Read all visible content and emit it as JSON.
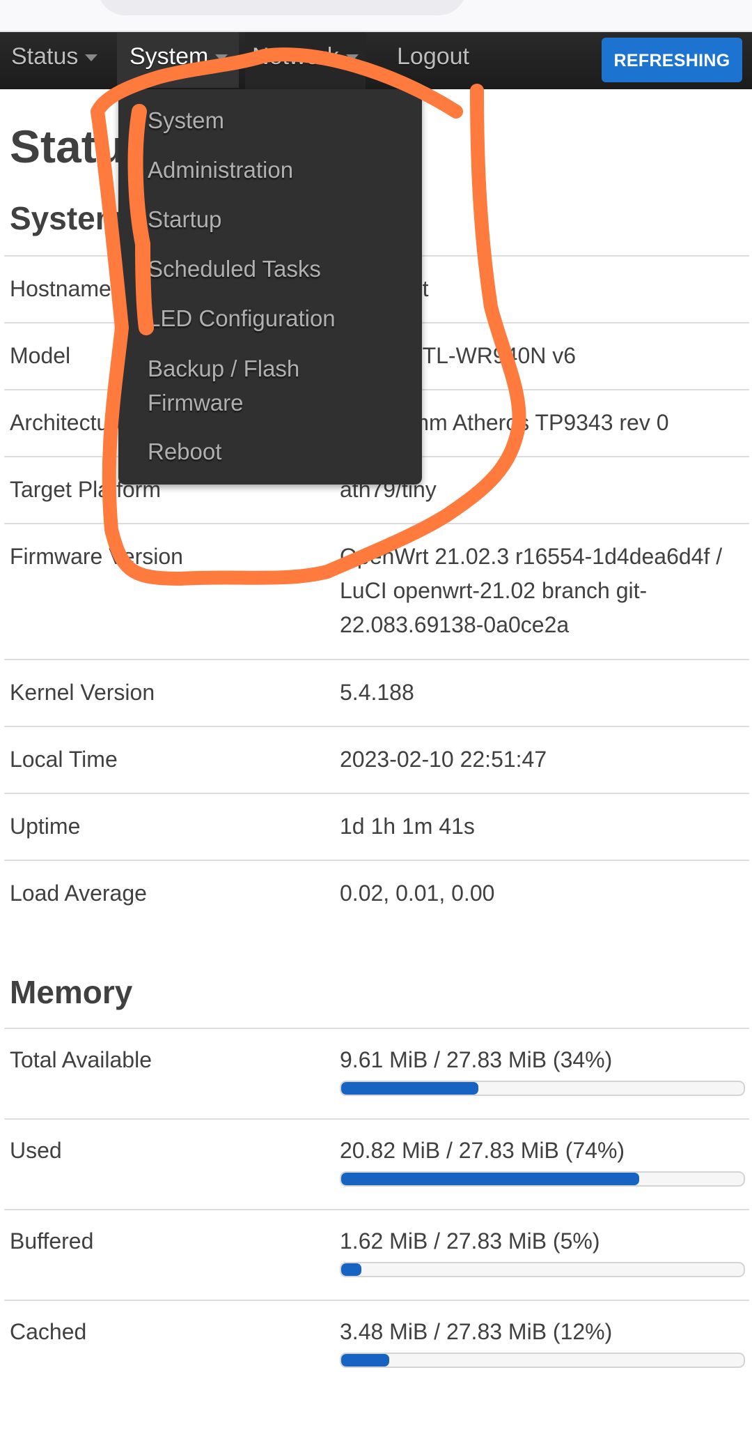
{
  "navbar": {
    "items": [
      {
        "label": "Status",
        "has_caret": true
      },
      {
        "label": "System",
        "has_caret": true,
        "active": true
      },
      {
        "label": "Network",
        "has_caret": true
      },
      {
        "label": "Logout",
        "has_caret": false
      }
    ],
    "refresh_button": "REFRESHING"
  },
  "dropdown": {
    "items": [
      "System",
      "Administration",
      "Startup",
      "Scheduled Tasks",
      "LED Configuration",
      "Backup / Flash Firmware",
      "Reboot"
    ]
  },
  "page": {
    "title": "Status",
    "system_section": "System",
    "memory_section": "Memory"
  },
  "system": {
    "rows": [
      {
        "label": "Hostname",
        "value": "OpenWrt"
      },
      {
        "label": "Model",
        "value": "TP-Link TL-WR940N v6"
      },
      {
        "label": "Architecture",
        "value": "Qualcomm Atheros TP9343 rev 0"
      },
      {
        "label": "Target Platform",
        "value": "ath79/tiny"
      },
      {
        "label": "Firmware Version",
        "value": "OpenWrt 21.02.3 r16554-1d4dea6d4f / LuCI openwrt-21.02 branch git-22.083.69138-0a0ce2a"
      },
      {
        "label": "Kernel Version",
        "value": "5.4.188"
      },
      {
        "label": "Local Time",
        "value": "2023-02-10 22:51:47"
      },
      {
        "label": "Uptime",
        "value": "1d 1h 1m 41s"
      },
      {
        "label": "Load Average",
        "value": "0.02, 0.01, 0.00"
      }
    ]
  },
  "memory": {
    "rows": [
      {
        "label": "Total Available",
        "value": "9.61 MiB / 27.83 MiB (34%)",
        "percent": 34
      },
      {
        "label": "Used",
        "value": "20.82 MiB / 27.83 MiB (74%)",
        "percent": 74
      },
      {
        "label": "Buffered",
        "value": "1.62 MiB / 27.83 MiB (5%)",
        "percent": 5
      },
      {
        "label": "Cached",
        "value": "3.48 MiB / 27.83 MiB (12%)",
        "percent": 12
      }
    ]
  },
  "colors": {
    "accent": "#1d74d0",
    "bar_fill": "#1763c2",
    "annotation": "#ff7a3d",
    "navbar": "#222222",
    "dropdown": "#303030"
  }
}
